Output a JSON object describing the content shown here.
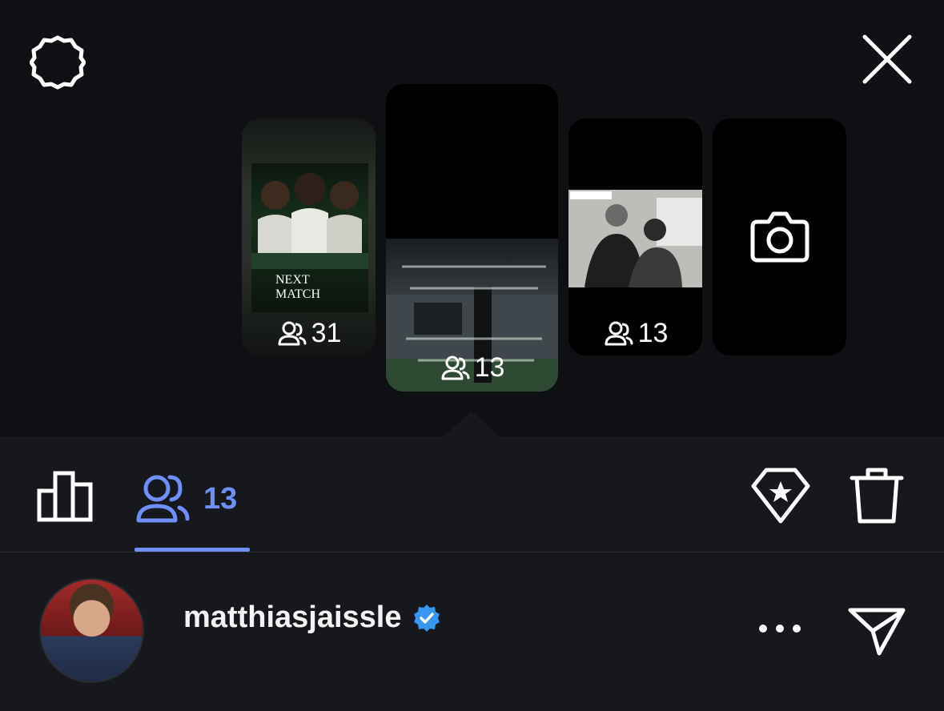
{
  "stories": [
    {
      "viewer_count": "31",
      "poster_title_line1": "NEXT",
      "poster_title_line2": "MATCH"
    },
    {
      "viewer_count": "13"
    },
    {
      "viewer_count": "13"
    },
    {
      "type": "camera"
    }
  ],
  "toolbar": {
    "viewers_count": "13"
  },
  "viewer": {
    "username": "matthiasjaissle",
    "verified": true
  },
  "colors": {
    "accent": "#6f8ef6",
    "background": "#0e1014",
    "panel": "#16181d",
    "verified": "#3897f0"
  },
  "icons": [
    "settings-icon",
    "close-icon",
    "viewers-icon",
    "camera-icon",
    "insights-icon",
    "highlight-icon",
    "delete-icon",
    "more-icon",
    "send-icon",
    "verified-icon"
  ]
}
